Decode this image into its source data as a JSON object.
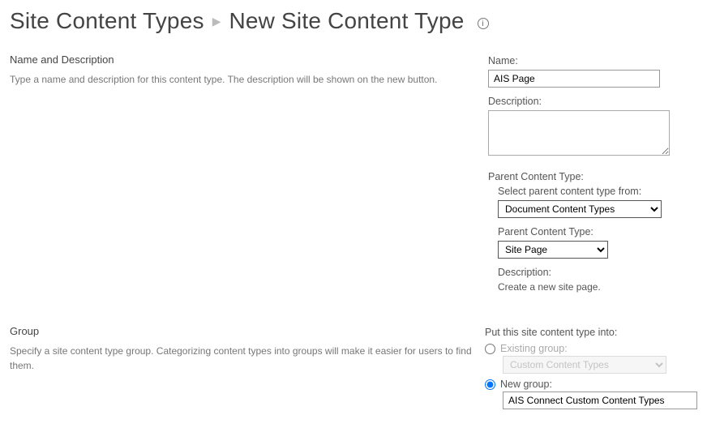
{
  "breadcrumb": {
    "root": "Site Content Types",
    "current": "New Site Content Type"
  },
  "sections": {
    "nameDesc": {
      "title": "Name and Description",
      "desc": "Type a name and description for this content type. The description will be shown on the new button."
    },
    "group": {
      "title": "Group",
      "desc": "Specify a site content type group. Categorizing content types into groups will make it easier for users to find them."
    }
  },
  "fields": {
    "name": {
      "label": "Name:",
      "value": "AIS Page"
    },
    "description": {
      "label": "Description:",
      "value": ""
    },
    "parentHeading": "Parent Content Type:",
    "parentFrom": {
      "label": "Select parent content type from:",
      "value": "Document Content Types"
    },
    "parentType": {
      "label": "Parent Content Type:",
      "value": "Site Page"
    },
    "parentDesc": {
      "label": "Description:",
      "text": "Create a new site page."
    },
    "groupHeading": "Put this site content type into:",
    "existingGroup": {
      "label": "Existing group:",
      "value": "Custom Content Types"
    },
    "newGroup": {
      "label": "New group:",
      "value": "AIS Connect Custom Content Types"
    }
  }
}
